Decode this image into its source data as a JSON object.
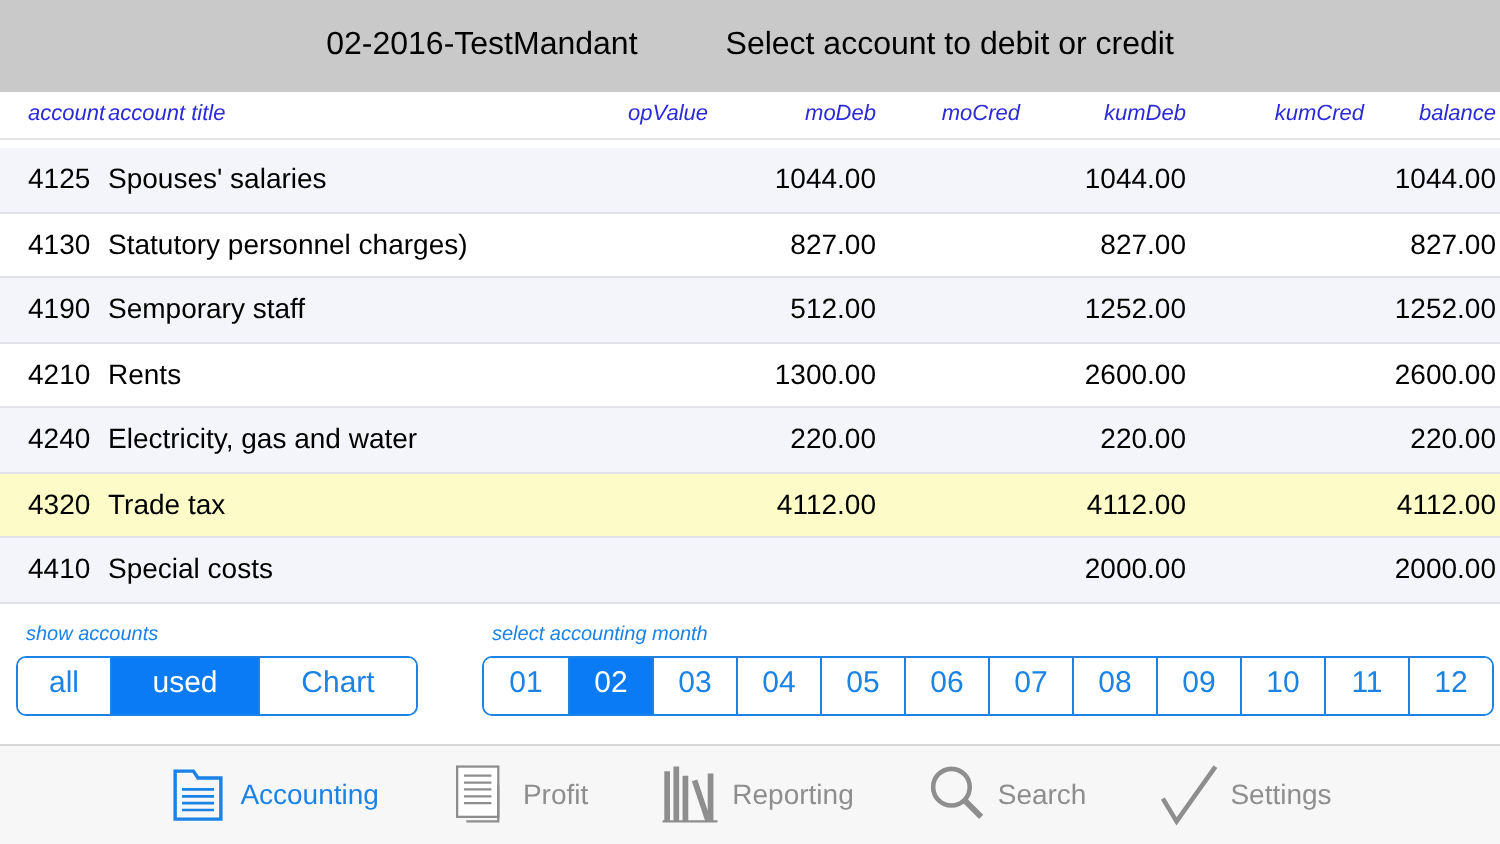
{
  "header": {
    "mandant": "02-2016-TestMandant",
    "title": "Select account to debit or credit"
  },
  "table": {
    "columns": [
      "account",
      "account title",
      "opValue",
      "moDeb",
      "moCred",
      "kumDeb",
      "kumCred",
      "balance"
    ],
    "rows": [
      {
        "cells": [
          "4125",
          "Spouses' salaries",
          "",
          "1044.00",
          "",
          "1044.00",
          "",
          "1044.00"
        ],
        "selected": false
      },
      {
        "cells": [
          "4130",
          "Statutory personnel charges)",
          "",
          "827.00",
          "",
          "827.00",
          "",
          "827.00"
        ],
        "selected": false
      },
      {
        "cells": [
          "4190",
          "Semporary staff",
          "",
          "512.00",
          "",
          "1252.00",
          "",
          "1252.00"
        ],
        "selected": false
      },
      {
        "cells": [
          "4210",
          "Rents",
          "",
          "1300.00",
          "",
          "2600.00",
          "",
          "2600.00"
        ],
        "selected": false
      },
      {
        "cells": [
          "4240",
          "Electricity, gas and water",
          "",
          "220.00",
          "",
          "220.00",
          "",
          "220.00"
        ],
        "selected": false
      },
      {
        "cells": [
          "4320",
          "Trade tax",
          "",
          "4112.00",
          "",
          "4112.00",
          "",
          "4112.00"
        ],
        "selected": true
      },
      {
        "cells": [
          "4410",
          "Special costs",
          "",
          "",
          "",
          "2000.00",
          "",
          "2000.00"
        ],
        "selected": false
      }
    ]
  },
  "show_accounts": {
    "label": "show accounts",
    "options": [
      {
        "label": "all",
        "selected": false
      },
      {
        "label": "used",
        "selected": true
      },
      {
        "label": "Chart",
        "selected": false
      }
    ]
  },
  "month_select": {
    "label": "select accounting month",
    "options": [
      {
        "label": "01",
        "selected": false
      },
      {
        "label": "02",
        "selected": true
      },
      {
        "label": "03",
        "selected": false
      },
      {
        "label": "04",
        "selected": false
      },
      {
        "label": "05",
        "selected": false
      },
      {
        "label": "06",
        "selected": false
      },
      {
        "label": "07",
        "selected": false
      },
      {
        "label": "08",
        "selected": false
      },
      {
        "label": "09",
        "selected": false
      },
      {
        "label": "10",
        "selected": false
      },
      {
        "label": "11",
        "selected": false
      },
      {
        "label": "12",
        "selected": false
      }
    ]
  },
  "tab_bar": [
    {
      "label": "Accounting",
      "selected": true,
      "kind": "folder"
    },
    {
      "label": "Profit",
      "selected": false,
      "kind": "pages"
    },
    {
      "label": "Reporting",
      "selected": false,
      "kind": "binders"
    },
    {
      "label": "Search",
      "selected": false,
      "kind": "search"
    },
    {
      "label": "Settings",
      "selected": false,
      "kind": "check"
    }
  ]
}
